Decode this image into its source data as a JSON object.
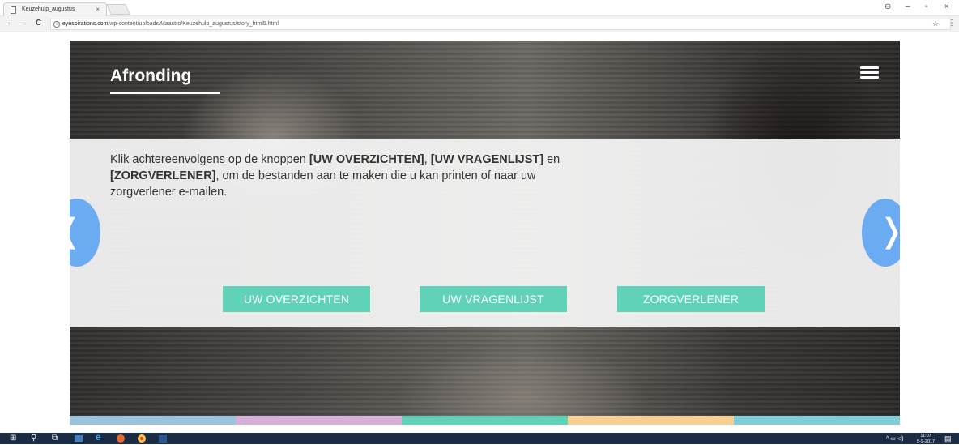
{
  "browser": {
    "tab_title": "Keuzehulp_augustus",
    "tab_close": "×",
    "url_domain": "eyespirations.com",
    "url_path": "/wp-content/uploads/Maastro/Keuzehulp_augustus/story_html5.html",
    "window_controls": {
      "user": "⊖",
      "minimize": "–",
      "restore": "▫",
      "close": "×"
    },
    "nav": {
      "back": "←",
      "forward": "→",
      "reload": "C"
    },
    "info_glyph": "i",
    "star_glyph": "☆",
    "menu_glyph": "⋮"
  },
  "slide": {
    "title": "Afronding",
    "instruction": {
      "p1": "Klik achtereenvolgens op de knoppen ",
      "b1": "[UW OVERZICHTEN]",
      "p2": ", ",
      "b2": "[UW VRAGENLIJST]",
      "p3": " en ",
      "b3": "[ZORGVERLENER]",
      "p4": ", om de bestanden aan te maken die u kan printen of naar uw zorgverlener e-mailen."
    },
    "buttons": {
      "overzichten": "UW OVERZICHTEN",
      "vragenlijst": "UW VRAGENLIJST",
      "zorgverlener": "ZORGVERLENER"
    },
    "prev_glyph": "❬",
    "next_glyph": "❭",
    "colors": {
      "button": "#5fd2b8",
      "arrow": "#6aabf2",
      "bar": [
        "#9cc3de",
        "#d6b0d8",
        "#5fd2b8",
        "#f7cf94",
        "#80ccd9"
      ]
    }
  },
  "taskbar": {
    "start": "⊞",
    "search": "⚲",
    "taskview": "⧉",
    "tray_time": "11:07",
    "tray_date": "5-9-2017"
  }
}
